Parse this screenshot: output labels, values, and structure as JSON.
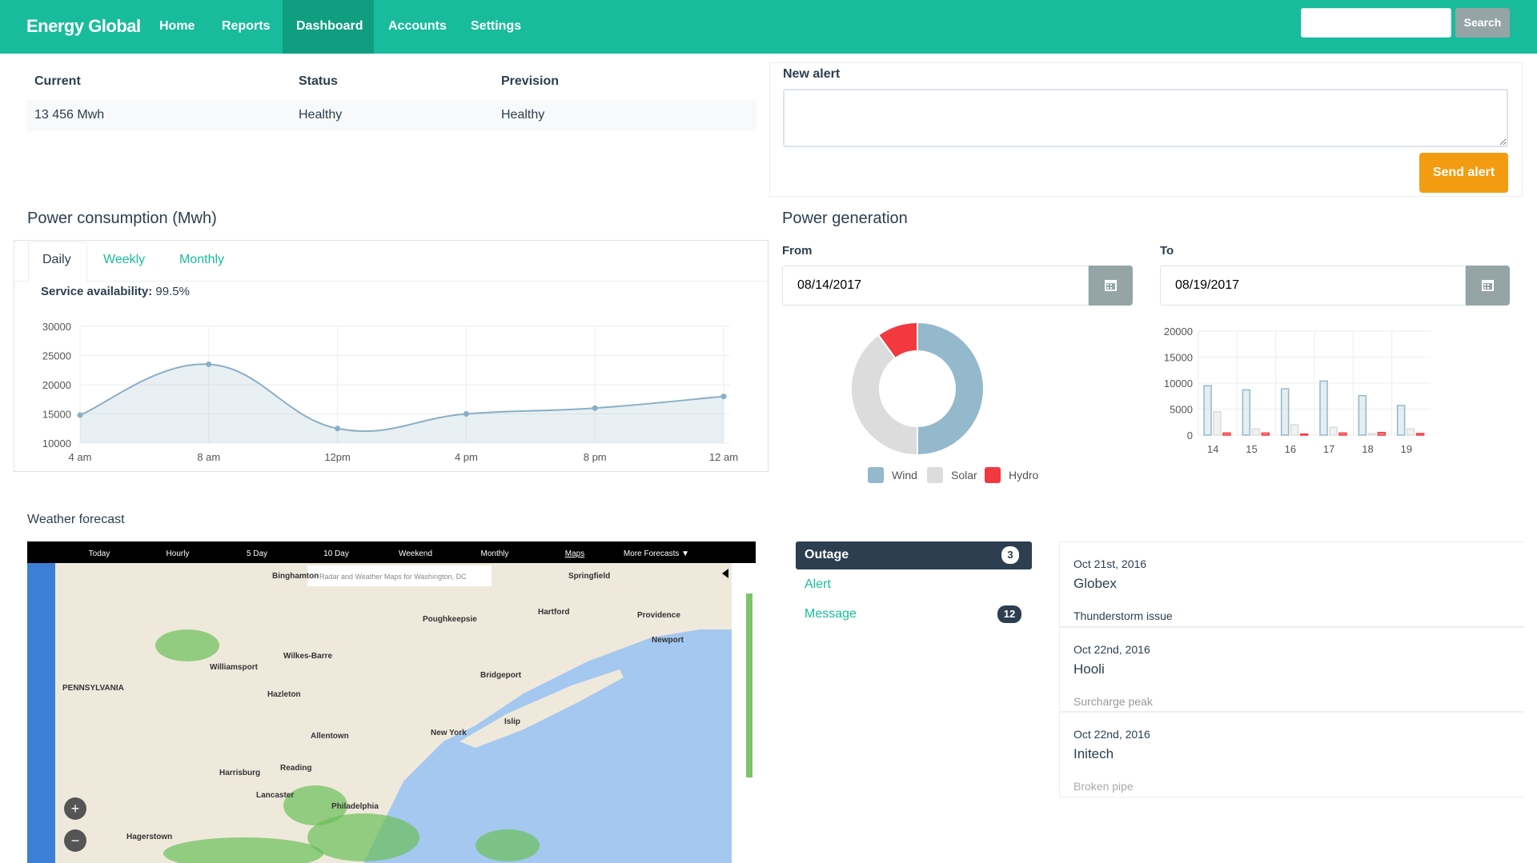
{
  "nav": {
    "brand": "Energy Global",
    "items": [
      "Home",
      "Reports",
      "Dashboard",
      "Accounts",
      "Settings"
    ],
    "active": "Dashboard",
    "search_value": "",
    "search_button": "Search"
  },
  "summary": {
    "headers": [
      "Current",
      "Status",
      "Prevision"
    ],
    "row": [
      "13 456 Mwh",
      "Healthy",
      "Healthy"
    ]
  },
  "alert": {
    "label": "New alert",
    "value": "",
    "button": "Send alert"
  },
  "consumption": {
    "title": "Power consumption (Mwh)",
    "tabs": [
      "Daily",
      "Weekly",
      "Monthly"
    ],
    "active_tab": "Daily",
    "availability_label": "Service availability:",
    "availability_value": "99.5%"
  },
  "generation": {
    "title": "Power generation",
    "from_label": "From",
    "from_value": "08/14/2017",
    "to_label": "To",
    "to_value": "08/19/2017"
  },
  "weather": {
    "title": "Weather forecast",
    "toolbar": [
      "Today",
      "Hourly",
      "5 Day",
      "10 Day",
      "Weekend",
      "Monthly",
      "Maps",
      "More Forecasts ▼"
    ],
    "map_title": "Radar and Weather Maps for Washington, DC",
    "cities": [
      "Springfield",
      "Binghamton",
      "Hartford",
      "Providence",
      "Poughkeepsie",
      "Bridgeport",
      "New York",
      "Islip",
      "Allentown",
      "Reading",
      "Philadelphia",
      "Harrisburg",
      "Lancaster",
      "Williamsport",
      "PENNSYLVANIA",
      "Newport",
      "Hazleton",
      "Wilkes-Barre",
      "Hagerstown"
    ]
  },
  "events": {
    "categories": [
      {
        "label": "Outage",
        "count": "3"
      },
      {
        "label": "Alert",
        "count": ""
      },
      {
        "label": "Message",
        "count": "12"
      }
    ],
    "active": "Outage",
    "items": [
      {
        "date": "Oct 21st, 2016",
        "name": "Globex",
        "message": "Thunderstorm issue"
      },
      {
        "date": "Oct 22nd, 2016",
        "name": "Hooli",
        "message": "Surcharge peak"
      },
      {
        "date": "Oct 22nd, 2016",
        "name": "Initech",
        "message": "Broken pipe"
      }
    ]
  },
  "chart_data": [
    {
      "type": "area",
      "categories": [
        "4 am",
        "8 am",
        "12pm",
        "4 pm",
        "8 pm",
        "12 am"
      ],
      "values": [
        14800,
        23500,
        12500,
        15000,
        16000,
        18000
      ],
      "ylim": [
        10000,
        30000
      ],
      "yticks": [
        "30000",
        "25000",
        "20000",
        "15000",
        "10000"
      ],
      "grid": true,
      "color": "#8aaec6"
    },
    {
      "type": "pie",
      "categories": [
        "Wind",
        "Solar",
        "Hydro"
      ],
      "values": [
        50,
        40,
        10
      ],
      "colors": [
        "#94b8cc",
        "#dcdcdc",
        "#f2393f"
      ],
      "legend": "bottom"
    },
    {
      "type": "bar",
      "categories": [
        "14",
        "15",
        "16",
        "17",
        "18",
        "19"
      ],
      "series": [
        {
          "name": "Wind",
          "values": [
            9500,
            8700,
            8900,
            10400,
            7600,
            5700
          ]
        },
        {
          "name": "Solar",
          "values": [
            4500,
            1200,
            2000,
            1500,
            300,
            1200
          ]
        },
        {
          "name": "Hydro",
          "values": [
            400,
            400,
            200,
            400,
            500,
            300
          ]
        }
      ],
      "ylim": [
        0,
        20000
      ],
      "yticks": [
        "20000",
        "15000",
        "10000",
        "5000",
        "0"
      ],
      "grid": true
    }
  ]
}
